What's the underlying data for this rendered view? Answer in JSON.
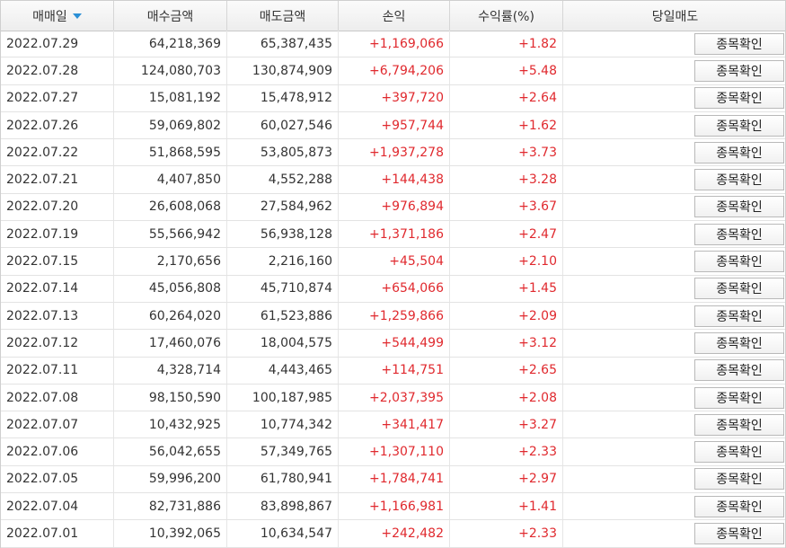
{
  "header": {
    "date": "매매일",
    "buy_amount": "매수금액",
    "sell_amount": "매도금액",
    "profit": "손익",
    "return_rate": "수익률(%)",
    "same_day_sell": "당일매도",
    "sort_icon": "sort-descending-icon",
    "sort_color": "#2a8fd6"
  },
  "button_label": "종목확인",
  "profit_color": "#e0292e",
  "rows": [
    {
      "date": "2022.07.29",
      "buy": "64,218,369",
      "sell": "65,387,435",
      "profit": "+1,169,066",
      "rate": "+1.82"
    },
    {
      "date": "2022.07.28",
      "buy": "124,080,703",
      "sell": "130,874,909",
      "profit": "+6,794,206",
      "rate": "+5.48"
    },
    {
      "date": "2022.07.27",
      "buy": "15,081,192",
      "sell": "15,478,912",
      "profit": "+397,720",
      "rate": "+2.64"
    },
    {
      "date": "2022.07.26",
      "buy": "59,069,802",
      "sell": "60,027,546",
      "profit": "+957,744",
      "rate": "+1.62"
    },
    {
      "date": "2022.07.22",
      "buy": "51,868,595",
      "sell": "53,805,873",
      "profit": "+1,937,278",
      "rate": "+3.73"
    },
    {
      "date": "2022.07.21",
      "buy": "4,407,850",
      "sell": "4,552,288",
      "profit": "+144,438",
      "rate": "+3.28"
    },
    {
      "date": "2022.07.20",
      "buy": "26,608,068",
      "sell": "27,584,962",
      "profit": "+976,894",
      "rate": "+3.67"
    },
    {
      "date": "2022.07.19",
      "buy": "55,566,942",
      "sell": "56,938,128",
      "profit": "+1,371,186",
      "rate": "+2.47"
    },
    {
      "date": "2022.07.15",
      "buy": "2,170,656",
      "sell": "2,216,160",
      "profit": "+45,504",
      "rate": "+2.10"
    },
    {
      "date": "2022.07.14",
      "buy": "45,056,808",
      "sell": "45,710,874",
      "profit": "+654,066",
      "rate": "+1.45"
    },
    {
      "date": "2022.07.13",
      "buy": "60,264,020",
      "sell": "61,523,886",
      "profit": "+1,259,866",
      "rate": "+2.09"
    },
    {
      "date": "2022.07.12",
      "buy": "17,460,076",
      "sell": "18,004,575",
      "profit": "+544,499",
      "rate": "+3.12"
    },
    {
      "date": "2022.07.11",
      "buy": "4,328,714",
      "sell": "4,443,465",
      "profit": "+114,751",
      "rate": "+2.65"
    },
    {
      "date": "2022.07.08",
      "buy": "98,150,590",
      "sell": "100,187,985",
      "profit": "+2,037,395",
      "rate": "+2.08"
    },
    {
      "date": "2022.07.07",
      "buy": "10,432,925",
      "sell": "10,774,342",
      "profit": "+341,417",
      "rate": "+3.27"
    },
    {
      "date": "2022.07.06",
      "buy": "56,042,655",
      "sell": "57,349,765",
      "profit": "+1,307,110",
      "rate": "+2.33"
    },
    {
      "date": "2022.07.05",
      "buy": "59,996,200",
      "sell": "61,780,941",
      "profit": "+1,784,741",
      "rate": "+2.97"
    },
    {
      "date": "2022.07.04",
      "buy": "82,731,886",
      "sell": "83,898,867",
      "profit": "+1,166,981",
      "rate": "+1.41"
    },
    {
      "date": "2022.07.01",
      "buy": "10,392,065",
      "sell": "10,634,547",
      "profit": "+242,482",
      "rate": "+2.33"
    }
  ]
}
